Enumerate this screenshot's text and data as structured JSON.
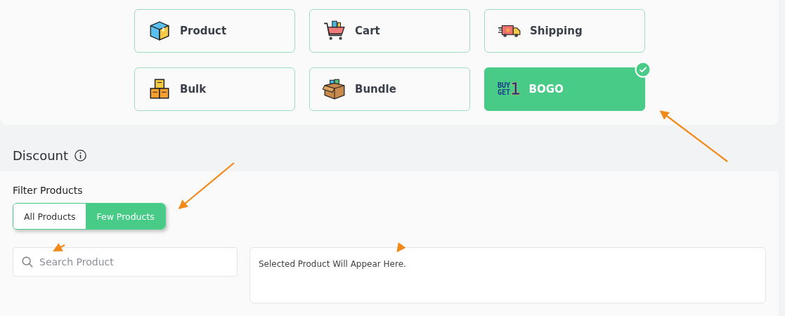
{
  "discount_types": [
    {
      "label": "Product",
      "selected": false
    },
    {
      "label": "Cart",
      "selected": false
    },
    {
      "label": "Shipping",
      "selected": false
    },
    {
      "label": "Bulk",
      "selected": false
    },
    {
      "label": "Bundle",
      "selected": false
    },
    {
      "label": "BOGO",
      "selected": true,
      "logo_text": [
        "BUY",
        "GET",
        "1"
      ]
    }
  ],
  "discount": {
    "title": "Discount",
    "filter_label": "Filter Products",
    "filter_options": [
      {
        "label": "All Products",
        "selected": false
      },
      {
        "label": "Few Products",
        "selected": true
      }
    ],
    "search": {
      "placeholder": "Search Product"
    },
    "selected_products": {
      "placeholder": "Selected Product Will Appear Here."
    }
  }
}
